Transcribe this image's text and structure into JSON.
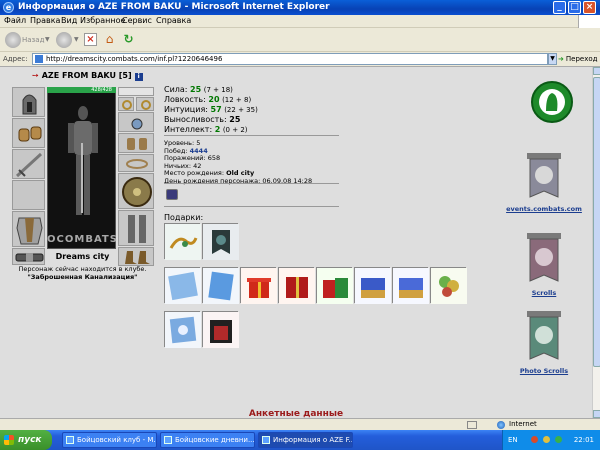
{
  "window": {
    "title": "Информация о AZE FROM BAKU - Microsoft Internet Explorer",
    "minimize_icon": "minimize-icon",
    "maximize_icon": "maximize-icon",
    "close_icon": "close-icon"
  },
  "menu": {
    "items": [
      "Файл",
      "Правка",
      "Вид",
      "Избранное",
      "Сервис",
      "Справка"
    ]
  },
  "toolbar": {
    "back_label": "Назад"
  },
  "address": {
    "label": "Адрес:",
    "url": "http://dreamscity.combats.com/inf.pl?1220646496",
    "go_label": "Переход"
  },
  "character": {
    "name": "AZE FROM BAKU",
    "level": "[5]",
    "hp": "428/428",
    "stats": [
      {
        "label": "Сила:",
        "value": "25",
        "bonus": "(7 + 18)",
        "green": true
      },
      {
        "label": "Ловкость:",
        "value": "20",
        "bonus": "(12 + 8)",
        "green": true
      },
      {
        "label": "Интуиция:",
        "value": "57",
        "bonus": "(22 + 35)",
        "green": true
      },
      {
        "label": "Выносливость:",
        "value": "25",
        "bonus": "",
        "green": false
      },
      {
        "label": "Интеллект:",
        "value": "2",
        "bonus": "(0 + 2)",
        "green": true
      }
    ],
    "info": {
      "level_line": "Уровень: 5",
      "wins_label": "Побед:",
      "wins": "4444",
      "losses": "Поражений: 658",
      "draws": "Ничьих: 42",
      "birthplace_label": "Место рождения:",
      "birthplace": "Old city",
      "birthday": "День рождения персонажа: 06.09.08 14:28"
    },
    "club_logo": "OCOMBATS",
    "club": "Dreams city",
    "location_text": "Персонаж сейчас находится в клубе.",
    "location_name": "\"Заброшенная Канализация\""
  },
  "gifts": {
    "label": "Подарки:"
  },
  "ads": [
    {
      "label": "events.combats.com",
      "color": "#1e8a2a"
    },
    {
      "label": "Scrolls",
      "color": "#8a6a7a"
    },
    {
      "label": "Photo Scrolls",
      "color": "#5a8a7a"
    }
  ],
  "section": {
    "title": "Анкетные данные"
  },
  "status": {
    "zone": "Internet"
  },
  "taskbar": {
    "start_label": "пуск",
    "tasks": [
      "Бойцовский клуб - М...",
      "Бойцовские дневни...",
      "Информация о AZE F..."
    ],
    "lang": "EN",
    "time": "22:01"
  }
}
